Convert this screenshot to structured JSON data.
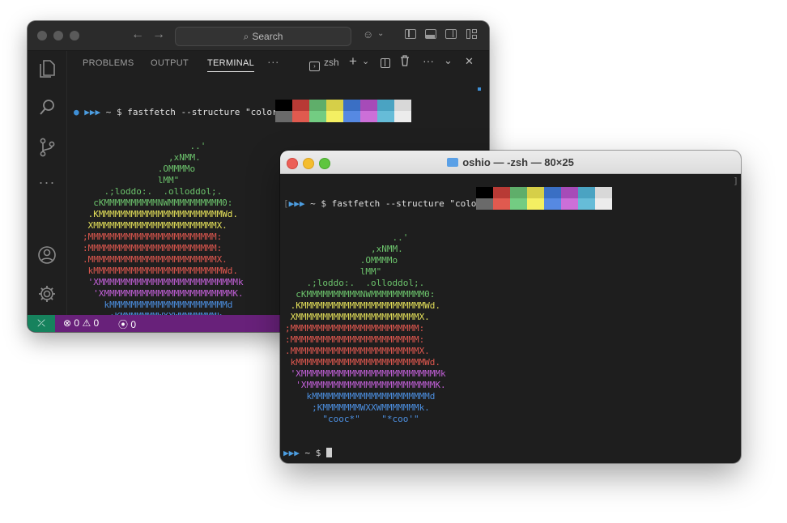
{
  "vscode": {
    "search_placeholder": "Search",
    "tabs": [
      {
        "label": "PROBLEMS",
        "active": false
      },
      {
        "label": "OUTPUT",
        "active": false
      },
      {
        "label": "TERMINAL",
        "active": true
      }
    ],
    "more": "···",
    "shell_label": "zsh",
    "status": {
      "errors": "0",
      "warnings": "0",
      "ports": "0"
    }
  },
  "terminal": {
    "title": "oshio — -zsh — 80×25"
  },
  "session": {
    "prompt_arrows": "▶▶▶",
    "prompt_rest": " ~ $ ",
    "command": "fastfetch --structure \"colors\"",
    "logo": [
      {
        "text": "                    ..'",
        "color": "#6cc36c"
      },
      {
        "text": "                ,xNMM.",
        "color": "#6cc36c"
      },
      {
        "text": "              .OMMMMo",
        "color": "#6cc36c"
      },
      {
        "text": "              lMM\"",
        "color": "#6cc36c"
      },
      {
        "text": "    .;loddo:.  .olloddol;.",
        "color": "#6cc36c"
      },
      {
        "text": "  cKMMMMMMMMMMNWMMMMMMMMMM0:",
        "color": "#6cc36c"
      },
      {
        "text": " .KMMMMMMMMMMMMMMMMMMMMMMMWd.",
        "color": "#e4e05a"
      },
      {
        "text": " XMMMMMMMMMMMMMMMMMMMMMMMX.",
        "color": "#e4e05a"
      },
      {
        "text": ";MMMMMMMMMMMMMMMMMMMMMMMM:",
        "color": "#e0584f"
      },
      {
        "text": ":MMMMMMMMMMMMMMMMMMMMMMMM:",
        "color": "#e0584f"
      },
      {
        "text": ".MMMMMMMMMMMMMMMMMMMMMMMMX.",
        "color": "#e0584f"
      },
      {
        "text": " kMMMMMMMMMMMMMMMMMMMMMMMMWd.",
        "color": "#e0584f"
      },
      {
        "text": " 'XMMMMMMMMMMMMMMMMMMMMMMMMMMk",
        "color": "#c260d8"
      },
      {
        "text": "  'XMMMMMMMMMMMMMMMMMMMMMMMMK.",
        "color": "#c260d8"
      },
      {
        "text": "    kMMMMMMMMMMMMMMMMMMMMMMd",
        "color": "#4c8fe0"
      },
      {
        "text": "     ;KMMMMMMMWXXWMMMMMMMk.",
        "color": "#4c8fe0"
      },
      {
        "text": "       \"cooc*\"    \"*coo'\"",
        "color": "#4c8fe0"
      }
    ],
    "palette_colors": [
      "#000000",
      "#b83a35",
      "#5fae6a",
      "#d6cf48",
      "#3a6fc4",
      "#a64bb8",
      "#4aa3c2",
      "#d8d8d8",
      "#6a6a6a",
      "#e05a4f",
      "#73cc82",
      "#f4ef62",
      "#5689e2",
      "#cc6fd8",
      "#66bcd8",
      "#ececec"
    ]
  },
  "colors": {
    "status_bar": "#68217a",
    "remote_button": "#16825d",
    "prompt": "#4c9de0"
  }
}
